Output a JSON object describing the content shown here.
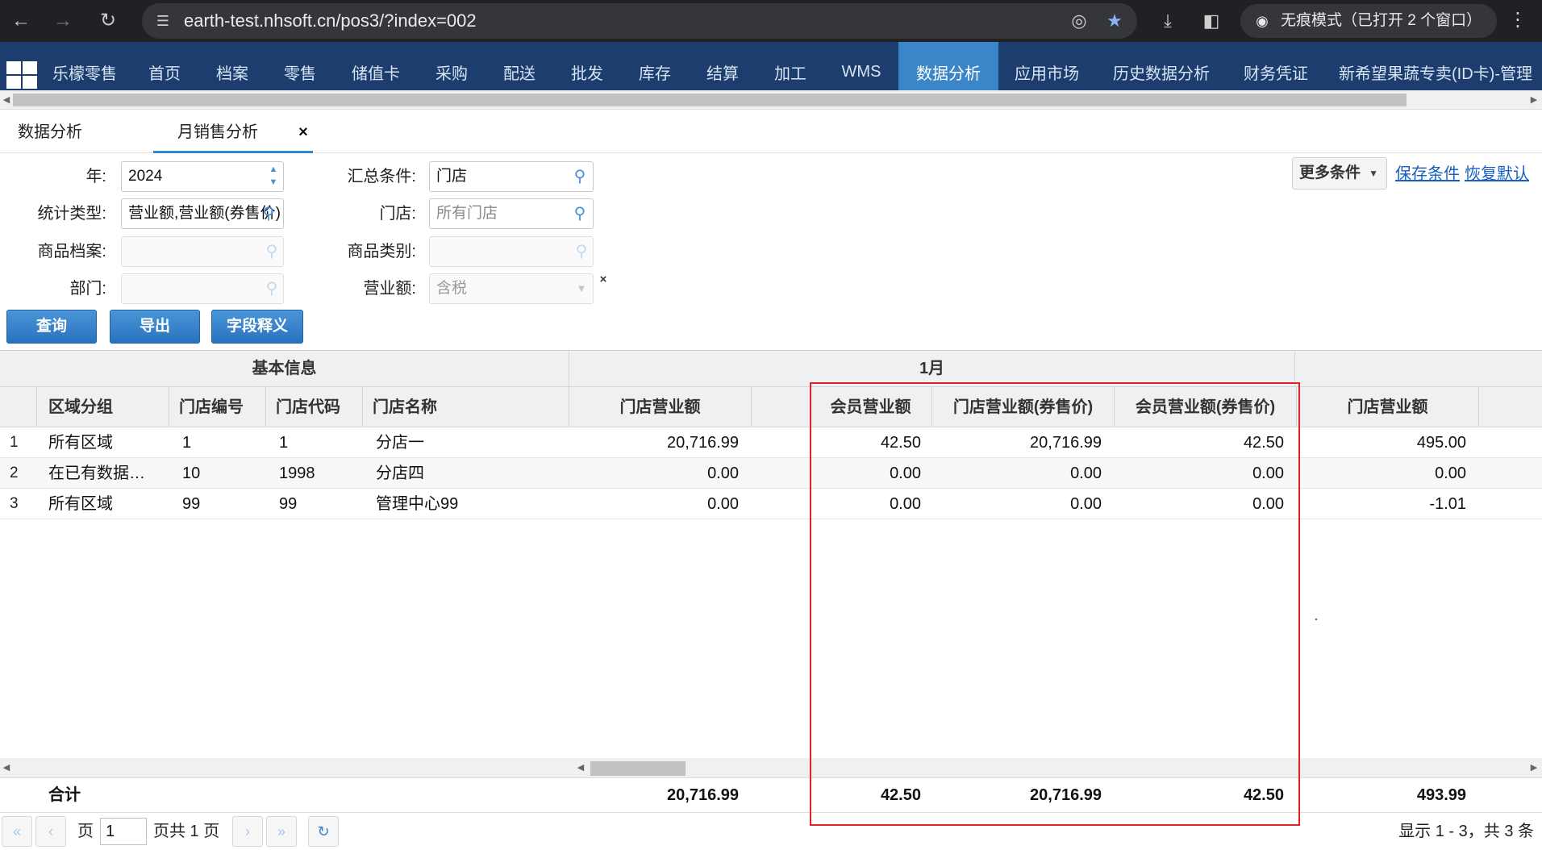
{
  "browser": {
    "url": "earth-test.nhsoft.cn/pos3/?index=002",
    "incognito_label": "无痕模式（已打开 2 个窗口）"
  },
  "topnav": {
    "items": [
      "乐檬零售",
      "首页",
      "档案",
      "零售",
      "储值卡",
      "采购",
      "配送",
      "批发",
      "库存",
      "结算",
      "加工",
      "WMS",
      "数据分析",
      "应用市场",
      "历史数据分析",
      "财务凭证",
      "新希望果蔬专卖(ID卡)-管理"
    ],
    "active": "数据分析"
  },
  "tabs": [
    {
      "label": "数据分析"
    },
    {
      "label": "月销售分析"
    }
  ],
  "filters": {
    "year_label": "年:",
    "year_value": "2024",
    "summary_label": "汇总条件:",
    "summary_value": "门店",
    "stat_type_label": "统计类型:",
    "stat_type_value": "营业额,营业额(券售价)",
    "store_label": "门店:",
    "store_placeholder": "所有门店",
    "product_label": "商品档案:",
    "category_label": "商品类别:",
    "dept_label": "部门:",
    "revenue_label": "营业额:",
    "revenue_value": "含税"
  },
  "buttons": {
    "query": "查询",
    "export": "导出",
    "field_def": "字段释义",
    "more_conditions": "更多条件",
    "save_conditions": "保存条件",
    "restore_default": "恢复默认"
  },
  "grid": {
    "group_headers": [
      "基本信息",
      "1月"
    ],
    "columns": [
      "区域分组",
      "门店编号",
      "门店代码",
      "门店名称",
      "门店营业额",
      "会员营业额",
      "门店营业额(券售价)",
      "会员营业额(券售价)",
      "门店营业额"
    ],
    "rows": [
      {
        "num": "1",
        "region": "所有区域",
        "store_no": "1",
        "store_code": "1",
        "store_name": "分店一",
        "store_rev": "20,716.99",
        "member_rev": "42.50",
        "store_rev_coupon": "20,716.99",
        "member_rev_coupon": "42.50",
        "next_store_rev": "495.00"
      },
      {
        "num": "2",
        "region": "在已有数据…",
        "store_no": "10",
        "store_code": "1998",
        "store_name": "分店四",
        "store_rev": "0.00",
        "member_rev": "0.00",
        "store_rev_coupon": "0.00",
        "member_rev_coupon": "0.00",
        "next_store_rev": "0.00"
      },
      {
        "num": "3",
        "region": "所有区域",
        "store_no": "99",
        "store_code": "99",
        "store_name": "管理中心99",
        "store_rev": "0.00",
        "member_rev": "0.00",
        "store_rev_coupon": "0.00",
        "member_rev_coupon": "0.00",
        "next_store_rev": "-1.01"
      }
    ],
    "totals": {
      "label": "合计",
      "store_rev": "20,716.99",
      "member_rev": "42.50",
      "store_rev_coupon": "20,716.99",
      "member_rev_coupon": "42.50",
      "next_store_rev": "493.99"
    }
  },
  "pager": {
    "page_label": "页",
    "page_value": "1",
    "total_pages": "页共 1 页",
    "summary": "显示 1 - 3，共 3 条"
  },
  "colors": {
    "nav_bg": "#1c3d6e",
    "nav_active": "#3a86c8",
    "button_blue": "#2a72bf",
    "highlight": "#e02424"
  }
}
